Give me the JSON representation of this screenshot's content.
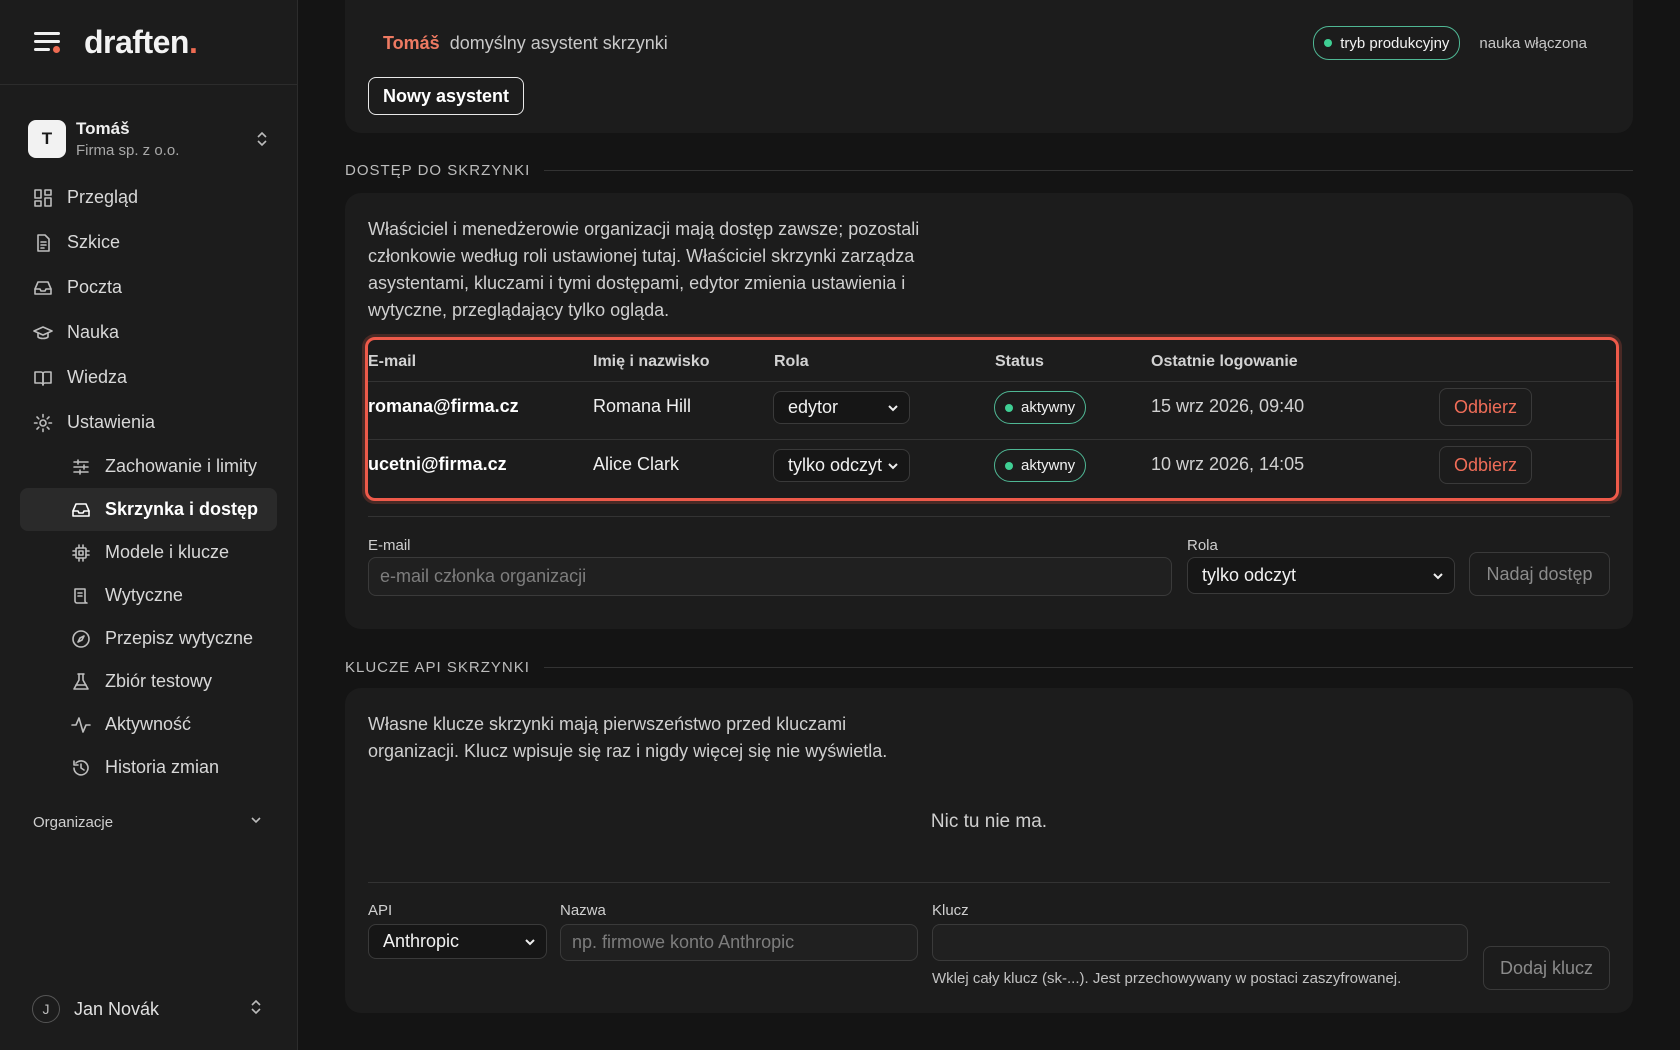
{
  "sidebar": {
    "brand": "draften",
    "brand_dot": ".",
    "account": {
      "initial": "T",
      "name": "Tomáš",
      "org": "Firma sp. z o.o."
    },
    "nav": [
      {
        "label": "Przegląd",
        "icon": "grid-icon"
      },
      {
        "label": "Szkice",
        "icon": "document-icon"
      },
      {
        "label": "Poczta",
        "icon": "inbox-icon"
      },
      {
        "label": "Nauka",
        "icon": "graduation-cap-icon"
      },
      {
        "label": "Wiedza",
        "icon": "book-icon"
      },
      {
        "label": "Ustawienia",
        "icon": "gear-icon"
      }
    ],
    "subnav": [
      {
        "label": "Zachowanie i limity",
        "icon": "sliders-icon"
      },
      {
        "label": "Skrzynka i dostęp",
        "icon": "inbox-icon",
        "active": true
      },
      {
        "label": "Modele i klucze",
        "icon": "chip-icon"
      },
      {
        "label": "Wytyczne",
        "icon": "scroll-icon"
      },
      {
        "label": "Przepisz wytyczne",
        "icon": "compass-icon"
      },
      {
        "label": "Zbiór testowy",
        "icon": "flask-icon"
      },
      {
        "label": "Aktywność",
        "icon": "activity-icon"
      },
      {
        "label": "Historia zmian",
        "icon": "history-icon"
      }
    ],
    "organizations_label": "Organizacje",
    "user": {
      "initial": "J",
      "name": "Jan Novák"
    }
  },
  "assistant": {
    "name": "Tomáš",
    "description": "domyślny asystent skrzynki",
    "mode_badge": "tryb produkcyjny",
    "learning": "nauka włączona",
    "new_button": "Nowy asystent"
  },
  "access": {
    "section_title": "DOSTĘP DO SKRZYNKI",
    "description": "Właściciel i menedżerowie organizacji mają dostęp zawsze; pozostali członkowie według roli ustawionej tutaj. Właściciel skrzynki zarządza asystentami, kluczami i tymi dostępami, edytor zmienia ustawienia i wytyczne, przeglądający tylko ogląda.",
    "columns": [
      "E-mail",
      "Imię i nazwisko",
      "Rola",
      "Status",
      "Ostatnie logowanie"
    ],
    "rows": [
      {
        "email": "romana@firma.cz",
        "name": "Romana Hill",
        "role": "edytor",
        "status": "aktywny",
        "last_login": "15 wrz 2026, 09:40",
        "action": "Odbierz"
      },
      {
        "email": "ucetni@firma.cz",
        "name": "Alice Clark",
        "role": "tylko odczyt",
        "status": "aktywny",
        "last_login": "10 wrz 2026, 14:05",
        "action": "Odbierz"
      }
    ],
    "form": {
      "email_label": "E-mail",
      "email_placeholder": "e-mail członka organizacji",
      "role_label": "Rola",
      "role_value": "tylko odczyt",
      "submit": "Nadaj dostęp"
    }
  },
  "keys": {
    "section_title": "KLUCZE API SKRZYNKI",
    "description": "Własne klucze skrzynki mają pierwszeństwo przed kluczami organizacji. Klucz wpisuje się raz i nigdy więcej się nie wyświetla.",
    "empty": "Nic tu nie ma.",
    "form": {
      "api_label": "API",
      "api_value": "Anthropic",
      "name_label": "Nazwa",
      "name_placeholder": "np. firmowe konto Anthropic",
      "key_label": "Klucz",
      "key_hint": "Wklej cały klucz (sk-...). Jest przechowywany w postaci zaszyfrowanej.",
      "submit": "Dodaj klucz"
    }
  },
  "colors": {
    "accent": "#ee6b52",
    "active_green": "#3fcf94",
    "highlight": "#ee5a4a"
  }
}
